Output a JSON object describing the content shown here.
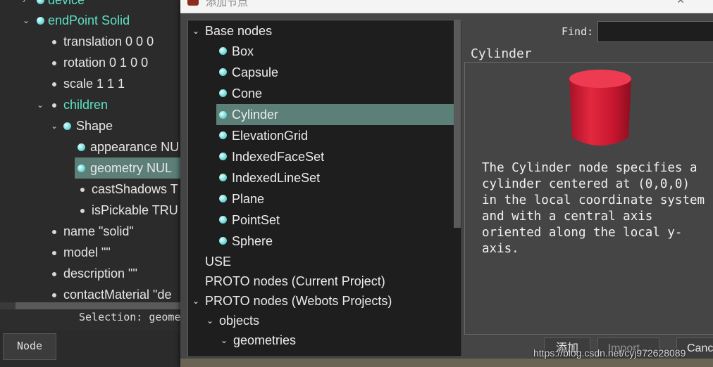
{
  "scene_tree": {
    "rows": [
      {
        "label": "device"
      },
      {
        "label": "endPoint Solid"
      },
      {
        "label": "translation 0 0 0"
      },
      {
        "label": "rotation 0 1 0 0"
      },
      {
        "label": "scale 1 1 1"
      },
      {
        "label": "children"
      },
      {
        "label": "Shape"
      },
      {
        "label": "appearance NU"
      },
      {
        "label": "geometry NUL"
      },
      {
        "label": "castShadows T"
      },
      {
        "label": "isPickable TRU"
      },
      {
        "label": "name \"solid\""
      },
      {
        "label": "model \"\""
      },
      {
        "label": "description \"\""
      },
      {
        "label": "contactMaterial \"de"
      }
    ],
    "selection_text": "Selection: geome",
    "node_tab_label": "Node"
  },
  "dialog": {
    "title": "添加节点",
    "find_label": "Find:",
    "find_value": "",
    "list": [
      {
        "label": "Base nodes"
      },
      {
        "label": "Box"
      },
      {
        "label": "Capsule"
      },
      {
        "label": "Cone"
      },
      {
        "label": "Cylinder"
      },
      {
        "label": "ElevationGrid"
      },
      {
        "label": "IndexedFaceSet"
      },
      {
        "label": "IndexedLineSet"
      },
      {
        "label": "Plane"
      },
      {
        "label": "PointSet"
      },
      {
        "label": "Sphere"
      },
      {
        "label": "USE"
      },
      {
        "label": "PROTO nodes (Current Project)"
      },
      {
        "label": "PROTO nodes (Webots Projects)"
      },
      {
        "label": "objects"
      },
      {
        "label": "geometries"
      }
    ],
    "preview_title": "Cylinder",
    "description": "The Cylinder node specifies a\ncylinder centered at (0,0,0)\nin the local coordinate system\nand with a central axis\noriented along the local y-\naxis.",
    "buttons": {
      "add": "添加",
      "import": "Import...",
      "cancel": "Canc"
    }
  },
  "watermark": "https://blog.csdn.net/cyj972628089",
  "colors": {
    "selection": "#5c7f78",
    "teal_text": "#5de0c4",
    "cylinder": "#d8223a"
  }
}
